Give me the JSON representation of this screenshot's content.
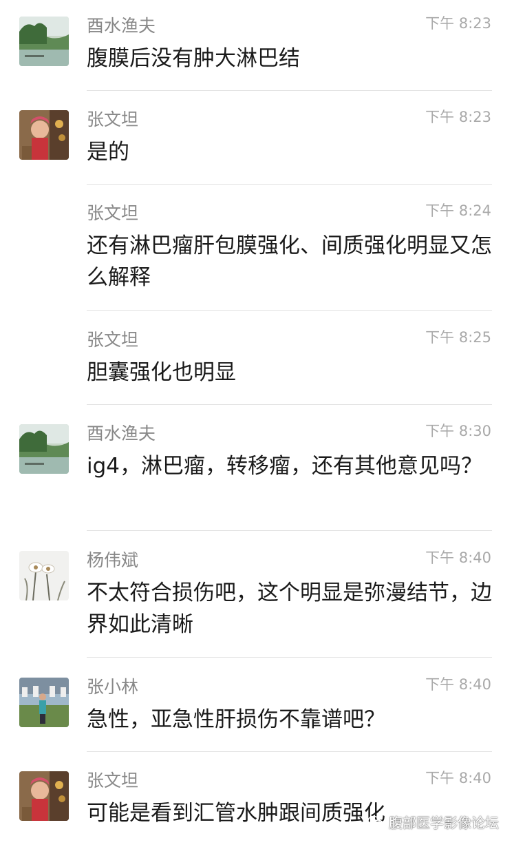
{
  "messages": [
    {
      "sender": "酉水渔夫",
      "time": "下午 8:23",
      "text": "腹膜后没有肿大淋巴结",
      "avatar": "riverside-landscape-avatar"
    },
    {
      "sender": "张文坦",
      "time": "下午 8:23",
      "text": "是的",
      "avatar": "child-photo-avatar"
    },
    {
      "sender": "张文坦",
      "time": "下午 8:24",
      "text": "还有淋巴瘤肝包膜强化、间质强化明显又怎么解释",
      "avatar": ""
    },
    {
      "sender": "张文坦",
      "time": "下午 8:25",
      "text": "胆囊强化也明显",
      "avatar": ""
    },
    {
      "sender": "酉水渔夫",
      "time": "下午 8:30",
      "text": "ig4，淋巴瘤，转移瘤，还有其他意见吗？",
      "avatar": "riverside-landscape-avatar"
    },
    {
      "sender": "杨伟斌",
      "time": "下午 8:40",
      "text": "不太符合损伤吧，这个明显是弥漫结节，边界如此清晰",
      "avatar": "white-flowers-avatar"
    },
    {
      "sender": "张小林",
      "time": "下午 8:40",
      "text": "急性，亚急性肝损伤不靠谱吧？",
      "avatar": "person-at-gate-avatar"
    },
    {
      "sender": "张文坦",
      "time": "下午 8:40",
      "text": "可能是看到汇管水肿跟间质强化",
      "avatar": "child-photo-avatar"
    }
  ],
  "watermark": {
    "text": "腹部医学影像论坛",
    "icon": "wechat-icon"
  }
}
